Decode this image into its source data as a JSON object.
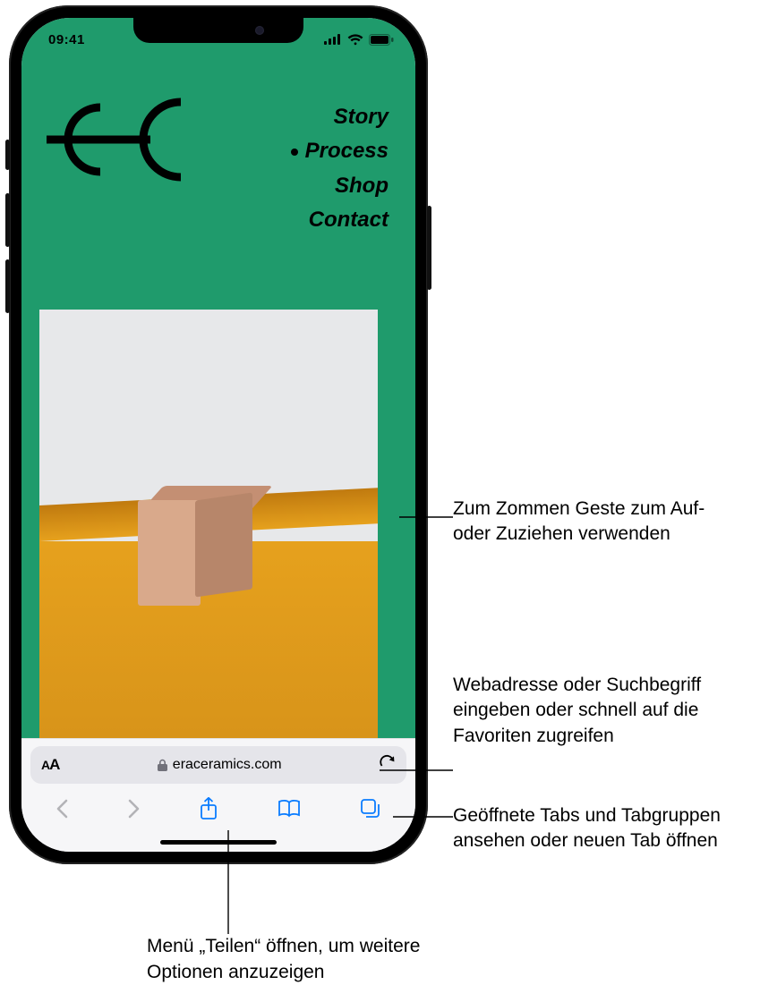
{
  "status": {
    "time": "09:41"
  },
  "site": {
    "nav": {
      "items": [
        {
          "label": "Story",
          "active": false
        },
        {
          "label": "Process",
          "active": true
        },
        {
          "label": "Shop",
          "active": false
        },
        {
          "label": "Contact",
          "active": false
        }
      ]
    }
  },
  "safari": {
    "urlbar": {
      "host": "eraceramics.com"
    }
  },
  "callouts": {
    "zoom": "Zum Zommen Geste zum Auf- oder Zuziehen verwenden",
    "address": "Webadresse oder Suchbegriff eingeben oder schnell auf die Favoriten zugreifen",
    "tabs": "Geöffnete Tabs und Tabgruppen ansehen oder neuen Tab öffnen",
    "share": "Menü „Teilen“ öffnen, um weitere Optionen anzuzeigen"
  }
}
